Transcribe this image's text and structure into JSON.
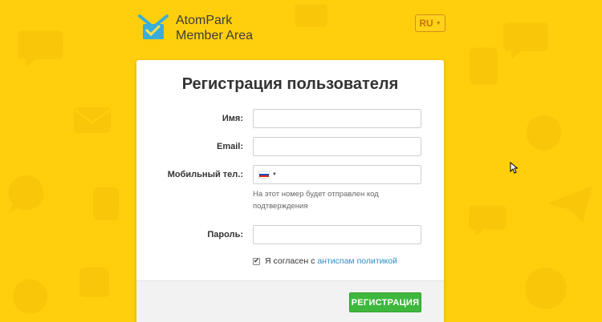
{
  "brand": {
    "name_line1": "AtomPark",
    "name_line2": "Member Area",
    "logo_icon": "envelope-check-icon"
  },
  "language": {
    "current": "RU",
    "caret": "▼"
  },
  "form": {
    "title": "Регистрация пользователя",
    "name": {
      "label": "Имя:",
      "value": ""
    },
    "email": {
      "label": "Email:",
      "value": ""
    },
    "phone": {
      "label": "Мобильный тел.:",
      "value": "",
      "country_flag": "russia-flag-icon",
      "hint": "На этот номер будет отправлен код подтверждения"
    },
    "password": {
      "label": "Пароль:",
      "value": ""
    },
    "agreement": {
      "checked": true,
      "check_mark": "✔",
      "text": "Я согласен с",
      "link_text": "антиспам политикой"
    },
    "submit_label": "РЕГИСТРАЦИЯ"
  },
  "colors": {
    "background": "#ffcf0d",
    "accent_green": "#3db83d",
    "link_blue": "#2a8fc4",
    "lang_border": "#d48c1a"
  }
}
